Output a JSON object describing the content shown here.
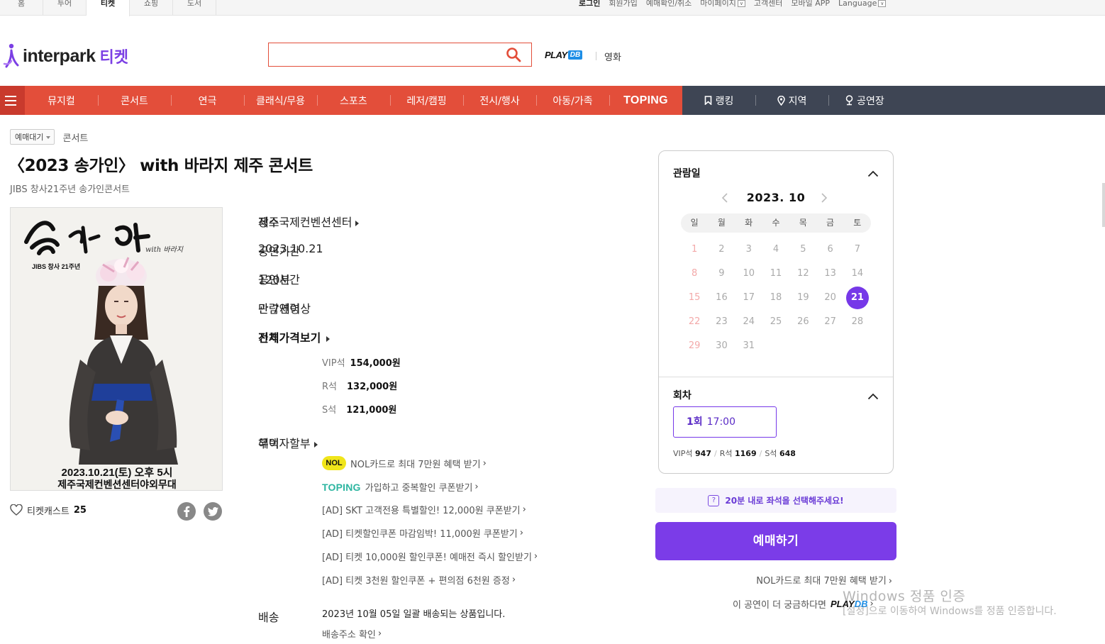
{
  "top_tabs": [
    "홈",
    "투어",
    "티켓",
    "쇼핑",
    "도서"
  ],
  "top_tab_active": 2,
  "util_links": {
    "login": "로그인",
    "join": "회원가입",
    "reservation_check": "예매확인/취소",
    "mypage": "마이페이지",
    "customer_center": "고객센터",
    "mobile_app": "모바일 APP",
    "language": "Language"
  },
  "header": {
    "logo_text": "interpark",
    "logo_sub": "티켓",
    "search_placeholder": "",
    "playdb_play": "PLAY",
    "playdb_db": "DB",
    "movie": "영화"
  },
  "gnb": {
    "red_items": [
      "뮤지컬",
      "콘서트",
      "연극",
      "클래식/무용",
      "스포츠",
      "레저/캠핑",
      "전시/행사",
      "아동/가족"
    ],
    "toping": "TOPING",
    "dark_items": [
      "랭킹",
      "지역",
      "공연장"
    ]
  },
  "product": {
    "badge": "예매대기",
    "genre": "콘서트",
    "title": "〈2023 송가인〉 with 바라지 제주 콘서트",
    "subtitle": "JIBS 창사21주년 송가인콘서트",
    "poster": {
      "calligraphy": "송가인",
      "with_text": "with 바라지",
      "jibs_text": "JIBS 창사 21주년",
      "date_line": "2023.10.21(토) 오후 5시",
      "venue_line": "제주국제컨벤션센터야외무대"
    },
    "ticketcast_label": "티켓캐스트",
    "ticketcast_count": "25"
  },
  "info": {
    "venue_label": "장소",
    "venue_value": "제주국제컨벤션센터",
    "period_label": "공연기간",
    "period_value": "2023.10.21",
    "runtime_label": "공연시간",
    "runtime_value": "120분",
    "age_label": "관람연령",
    "age_value": "만 7세이상",
    "price_label": "가격",
    "price_all": "전체가격보기",
    "prices": [
      {
        "grade": "VIP석",
        "price": "154,000원"
      },
      {
        "grade": "R석",
        "price": "132,000원"
      },
      {
        "grade": "S석",
        "price": "121,000원"
      }
    ],
    "benefit_label": "혜택",
    "benefit_main": "무이자할부",
    "benefits": [
      "NOL카드로 최대 7만원 혜택 받기",
      "가입하고 중복할인 쿠폰받기",
      "[AD] SKT 고객전용 특별할인! 12,000원 쿠폰받기",
      "[AD] 티켓할인쿠폰 마감임박! 11,000원 쿠폰받기",
      "[AD] 티켓 10,000원 할인쿠폰! 예매전 즉시 할인받기",
      "[AD] 티켓 3천원 할인쿠폰 + 편의점 6천원 증정"
    ],
    "nol_logo": "NOL",
    "toping_logo": "TOPING",
    "delivery_label": "배송",
    "delivery_value": "2023년 10월 05일 일괄 배송되는 상품입니다.",
    "delivery_check": "배송주소 확인"
  },
  "booking": {
    "date_title": "관람일",
    "month": "2023. 10",
    "weekdays": [
      "일",
      "월",
      "화",
      "수",
      "목",
      "금",
      "토"
    ],
    "days": [
      "1",
      "2",
      "3",
      "4",
      "5",
      "6",
      "7",
      "8",
      "9",
      "10",
      "11",
      "12",
      "13",
      "14",
      "15",
      "16",
      "17",
      "18",
      "19",
      "20",
      "21",
      "22",
      "23",
      "24",
      "25",
      "26",
      "27",
      "28",
      "29",
      "30",
      "31"
    ],
    "selected_day": "21",
    "round_title": "회차",
    "round_label": "1회",
    "round_time": "17:00",
    "seat_remaining": [
      {
        "grade": "VIP석",
        "count": "947"
      },
      {
        "grade": "R석",
        "count": "1169"
      },
      {
        "grade": "S석",
        "count": "648"
      }
    ],
    "notice": "20분 내로 좌석을 선택해주세요!",
    "book_button": "예매하기",
    "nol_promo": "NOL카드로 최대 7만원 혜택 받기",
    "more_text": "이 공연이 더 궁금하다면",
    "more_play": "PLAY",
    "more_db": "DB"
  },
  "watermark": {
    "line1": "Windows 정품 인증",
    "line2": "[설정]으로 이동하여 Windows를 정품 인증합니다."
  },
  "colors": {
    "gnb_red": "#e34e3a",
    "gnb_dark": "#3e4554",
    "accent_purple": "#7b3ce8",
    "nol_yellow": "#f0e51a",
    "toping_teal": "#2cb5a0"
  }
}
